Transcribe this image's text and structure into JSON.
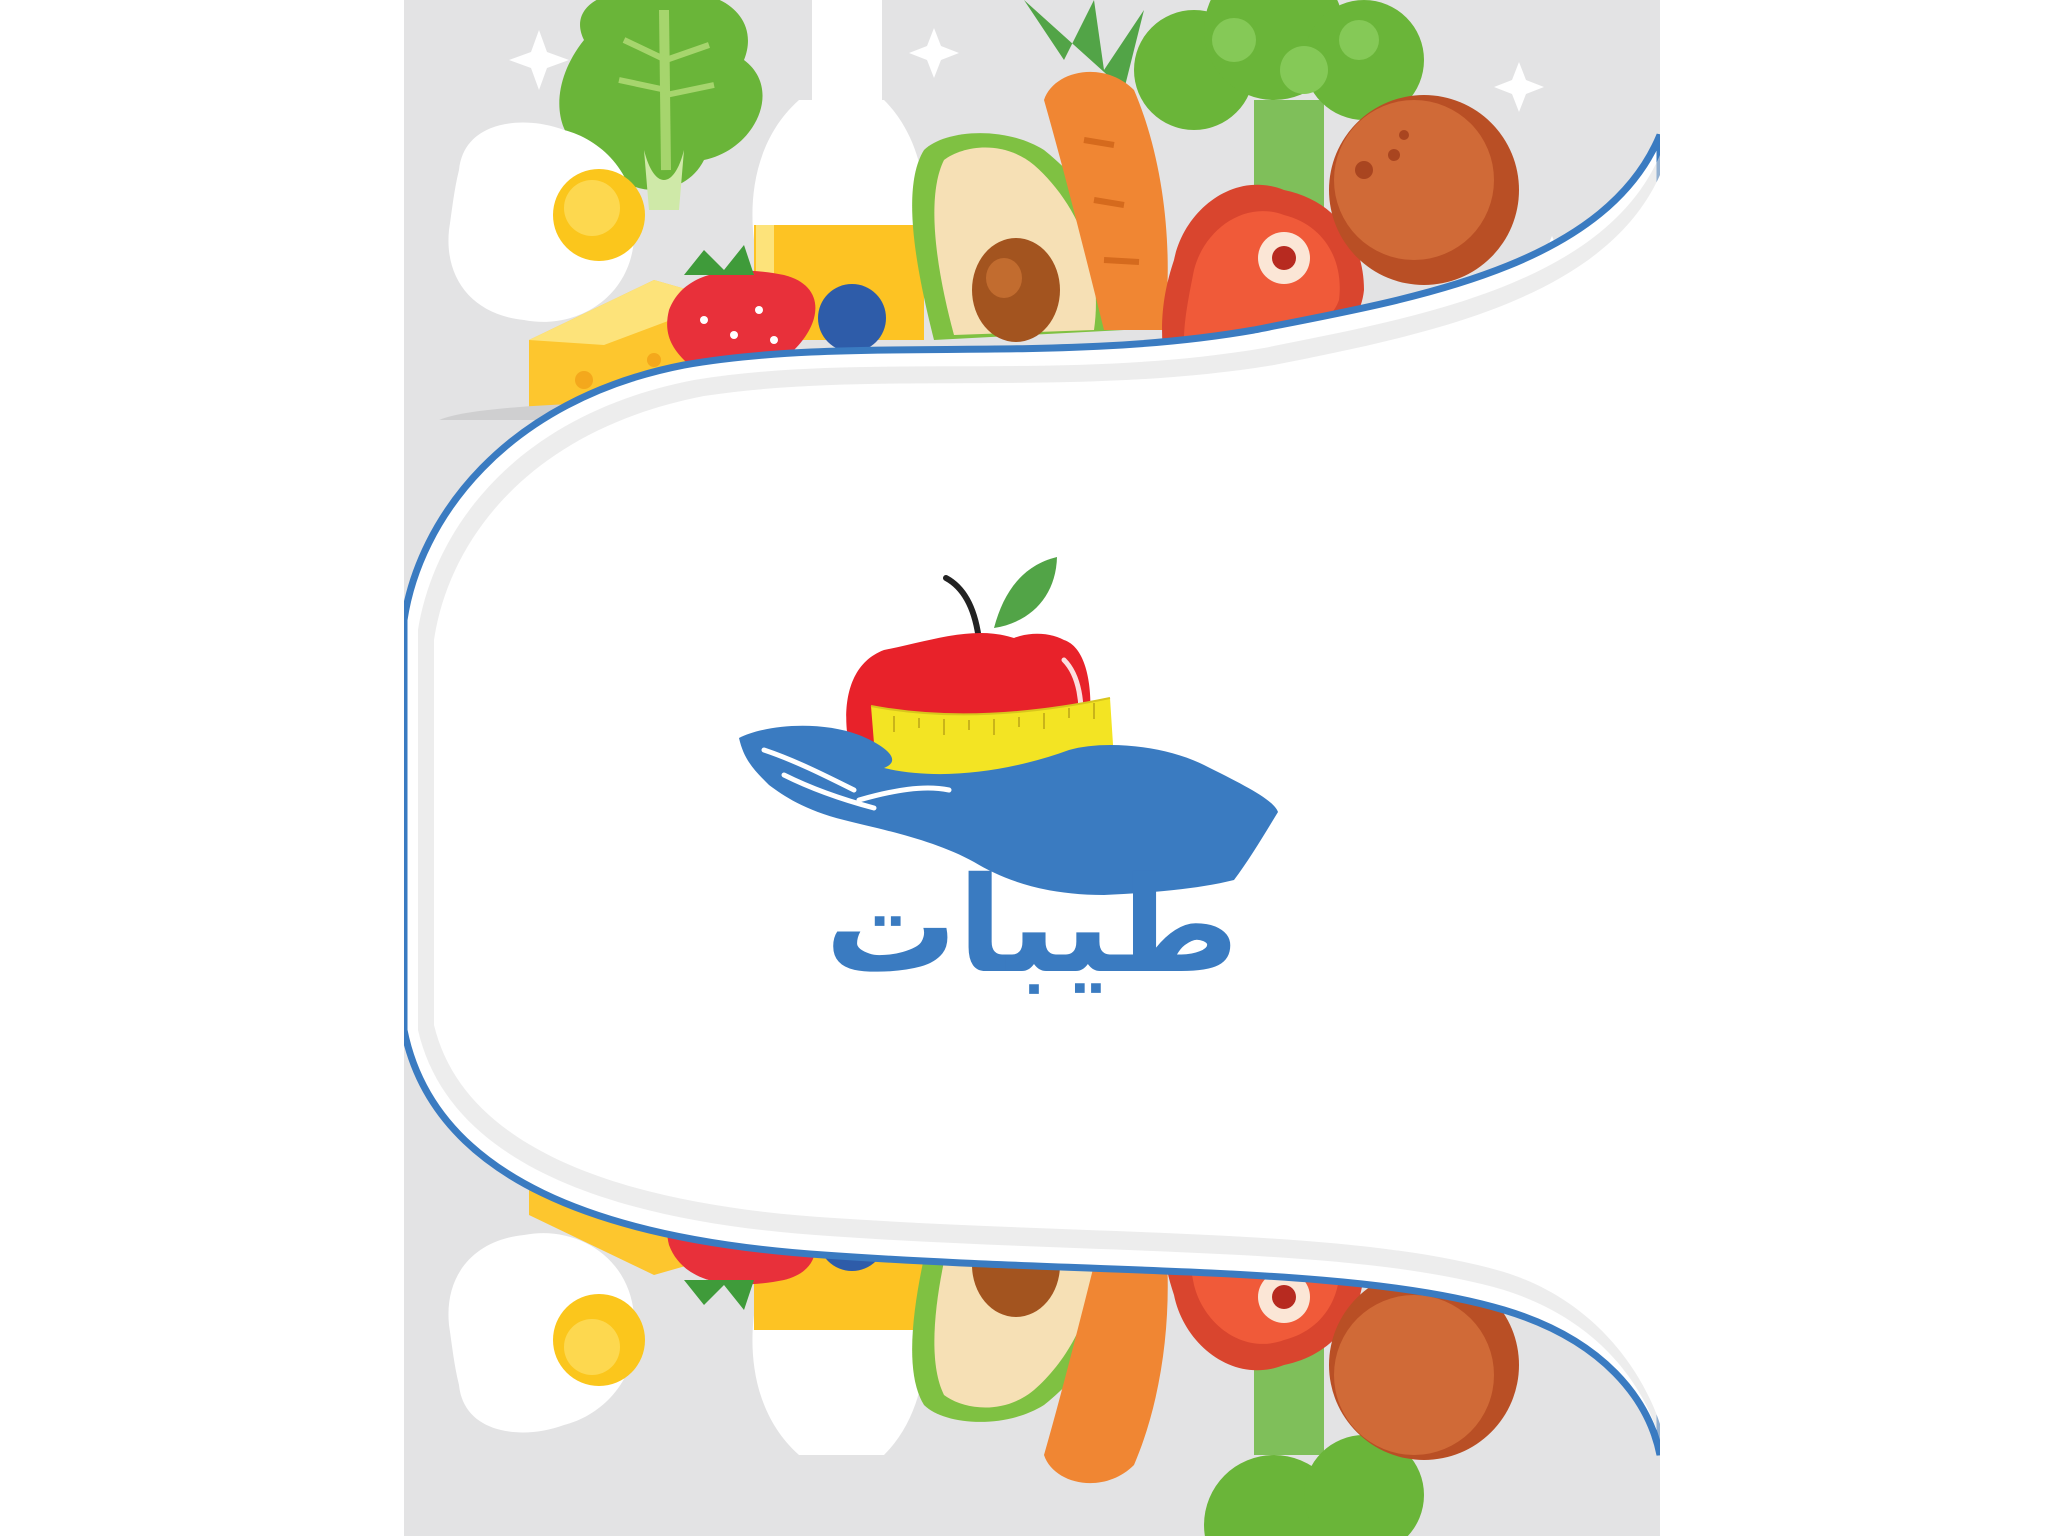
{
  "splash": {
    "brand_name": "طيبات",
    "logo_icon": "apple-in-hand-with-measuring-tape-icon",
    "background_illustration": "healthy-food-pattern"
  },
  "colors": {
    "brand_blue": "#3a7bc1",
    "apple_red": "#e8222a",
    "tape_yellow": "#f3e423",
    "leaf_green": "#52a447",
    "background_gray": "#e3e3e4"
  }
}
